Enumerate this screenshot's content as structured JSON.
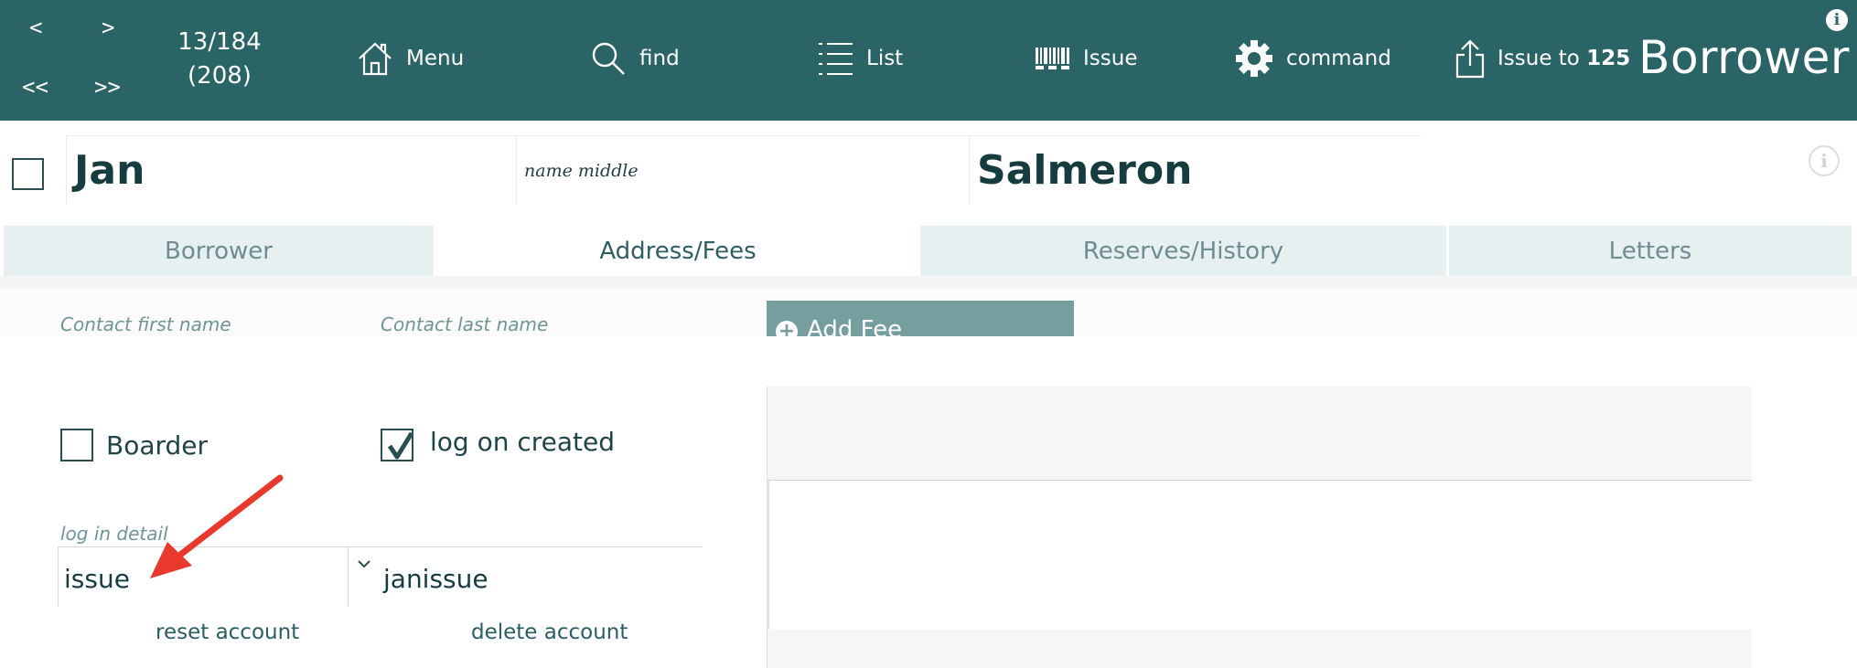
{
  "toolbar": {
    "nav": {
      "prev": "<",
      "next": ">",
      "first": "<<",
      "last": ">>"
    },
    "record_position": "13/184",
    "record_total": "(208)",
    "tools": [
      {
        "icon": "home-icon",
        "label": "Menu"
      },
      {
        "icon": "search-icon",
        "label": "find"
      },
      {
        "icon": "list-icon",
        "label": "List"
      },
      {
        "icon": "barcode-icon",
        "label": "Issue"
      },
      {
        "icon": "gear-icon",
        "label": "command"
      },
      {
        "icon": "upload-icon",
        "label": "Issue to",
        "count": "125"
      }
    ],
    "layout_title": "Borrower",
    "info_glyph": "i"
  },
  "record": {
    "first_name": "Jan",
    "middle_name_placeholder": "name middle",
    "last_name": "Salmeron"
  },
  "tabs": [
    {
      "label": "Borrower",
      "active": false
    },
    {
      "label": "Address/Fees",
      "active": true
    },
    {
      "label": "Reserves/History",
      "active": false
    },
    {
      "label": "Letters",
      "active": false
    }
  ],
  "contact": {
    "first_name_placeholder": "Contact first name",
    "last_name_placeholder": "Contact last name"
  },
  "fees": {
    "add_label": "Add Fee",
    "add_icon": "plus-circle-icon"
  },
  "options": {
    "boarder": {
      "label": "Boarder",
      "checked": false
    },
    "log_on_created": {
      "label": "log on created",
      "checked": true
    }
  },
  "login": {
    "label": "log in detail",
    "type_value": "issue",
    "account_value": "janissue",
    "reset_label": "reset account",
    "delete_label": "delete account"
  },
  "colors": {
    "toolbar_bg": "#2a6467",
    "tab_inactive_bg": "#e6f0f0",
    "add_fee_bg": "#779e9e",
    "annotation_arrow": "#e8392c"
  }
}
